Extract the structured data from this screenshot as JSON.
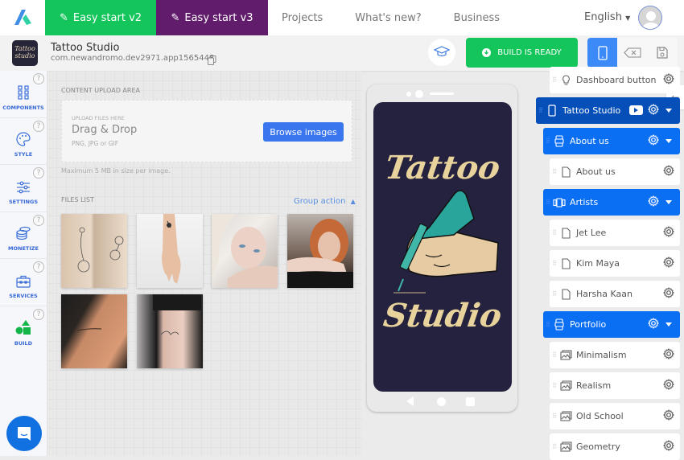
{
  "topbar": {
    "tabs": [
      {
        "label": "Easy start v2",
        "icon": "magic-wand-icon",
        "color": "#13c55a"
      },
      {
        "label": "Easy start v3",
        "icon": "magic-wand-icon",
        "color": "#621c6c"
      }
    ],
    "links": [
      "Projects",
      "What's new?",
      "Business"
    ],
    "language": "English"
  },
  "app": {
    "title": "Tattoo Studio",
    "package_id": "com.newandromo.dev2971.app1565448",
    "icon_text": "Tattoo studio"
  },
  "toolbar": {
    "build_label": "BUILD IS READY",
    "build_color": "#13c55a",
    "accent": "#3b8af7"
  },
  "sidebar": {
    "items": [
      {
        "label": "COMPONENTS",
        "icon": "grid-icon"
      },
      {
        "label": "STYLE",
        "icon": "palette-icon"
      },
      {
        "label": "SETTINGS",
        "icon": "sliders-icon"
      },
      {
        "label": "MONETIZE",
        "icon": "coins-icon"
      },
      {
        "label": "SERVICES",
        "icon": "toolbox-icon"
      },
      {
        "label": "BUILD",
        "icon": "shapes-icon"
      }
    ],
    "help": "?"
  },
  "content": {
    "upload_section_label": "CONTENT UPLOAD AREA",
    "upload_hint": "UPLOAD FILES HERE",
    "drag_drop": "Drag & Drop",
    "formats": "PNG, JPG or GIF",
    "browse_label": "Browse images",
    "max_size": "Maximum 5 MB in size per image.",
    "files_list_label": "FILES LIST",
    "group_action": "Group action",
    "files": [
      {
        "name": "tattoo-arms-doodle"
      },
      {
        "name": "tattoo-wrist"
      },
      {
        "name": "blonde-woman-arm-tattoo"
      },
      {
        "name": "redhead-woman-arm-tattoo"
      },
      {
        "name": "shoulder-script-tattoo"
      },
      {
        "name": "arm-love-tattoo"
      }
    ]
  },
  "preview": {
    "line1": "Tattoo",
    "line2": "Studio"
  },
  "tree": {
    "nodes": [
      {
        "label": "Dashboard button",
        "type": "item",
        "icon": "lightbulb-icon"
      },
      {
        "label": "Tattoo Studio",
        "type": "root",
        "icon": "phone-icon"
      },
      {
        "label": "About us",
        "type": "group",
        "icon": "robot-icon"
      },
      {
        "label": "About us",
        "type": "item",
        "icon": "page-icon"
      },
      {
        "label": "Artists",
        "type": "group",
        "icon": "carousel-icon"
      },
      {
        "label": "Jet Lee",
        "type": "item",
        "icon": "page-icon"
      },
      {
        "label": "Kim Maya",
        "type": "item",
        "icon": "page-icon"
      },
      {
        "label": "Harsha Kaan",
        "type": "item",
        "icon": "page-icon"
      },
      {
        "label": "Portfolio",
        "type": "group",
        "icon": "robot-icon"
      },
      {
        "label": "Minimalism",
        "type": "item",
        "icon": "gallery-icon"
      },
      {
        "label": "Realism",
        "type": "item",
        "icon": "gallery-icon"
      },
      {
        "label": "Old School",
        "type": "item",
        "icon": "gallery-icon"
      },
      {
        "label": "Geometry",
        "type": "item",
        "icon": "gallery-icon"
      }
    ]
  }
}
